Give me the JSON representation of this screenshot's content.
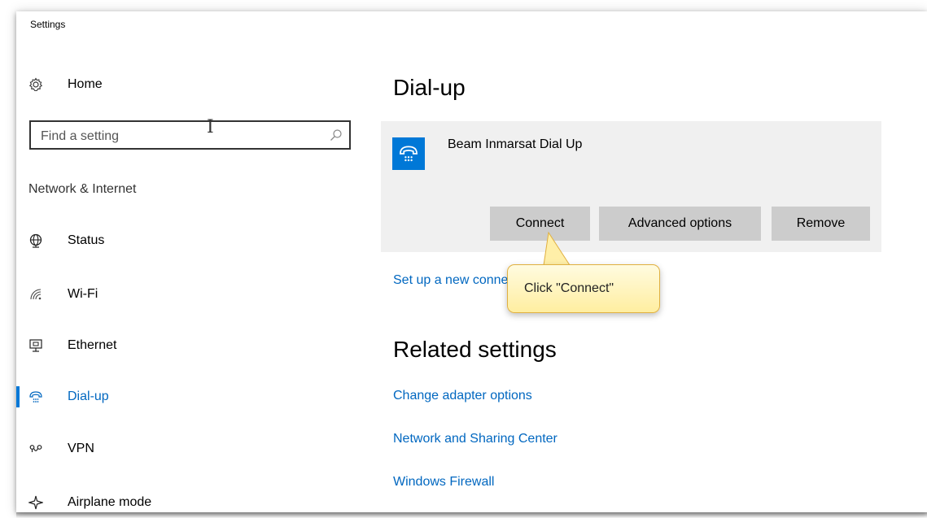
{
  "window": {
    "title": "Settings"
  },
  "sidebar": {
    "home_label": "Home",
    "search": {
      "placeholder": "Find a setting"
    },
    "section_label": "Network & Internet",
    "items": [
      {
        "label": "Status",
        "icon": "globe-icon"
      },
      {
        "label": "Wi-Fi",
        "icon": "wifi-icon"
      },
      {
        "label": "Ethernet",
        "icon": "ethernet-icon"
      },
      {
        "label": "Dial-up",
        "icon": "dialup-icon",
        "selected": true
      },
      {
        "label": "VPN",
        "icon": "vpn-icon"
      },
      {
        "label": "Airplane mode",
        "icon": "airplane-icon"
      }
    ]
  },
  "main": {
    "title": "Dial-up",
    "connection": {
      "name": "Beam Inmarsat Dial Up",
      "icon": "dialup-icon",
      "connect_label": "Connect",
      "advanced_label": "Advanced options",
      "remove_label": "Remove"
    },
    "setup_link": "Set up a new connection",
    "related_title": "Related settings",
    "related_links": [
      "Change adapter options",
      "Network and Sharing Center",
      "Windows Firewall"
    ]
  },
  "callout": {
    "text": "Click \"Connect\""
  },
  "colors": {
    "accent": "#0078d7",
    "link": "#0067c0",
    "panel": "#f0f0f0",
    "button": "#cccccc"
  }
}
